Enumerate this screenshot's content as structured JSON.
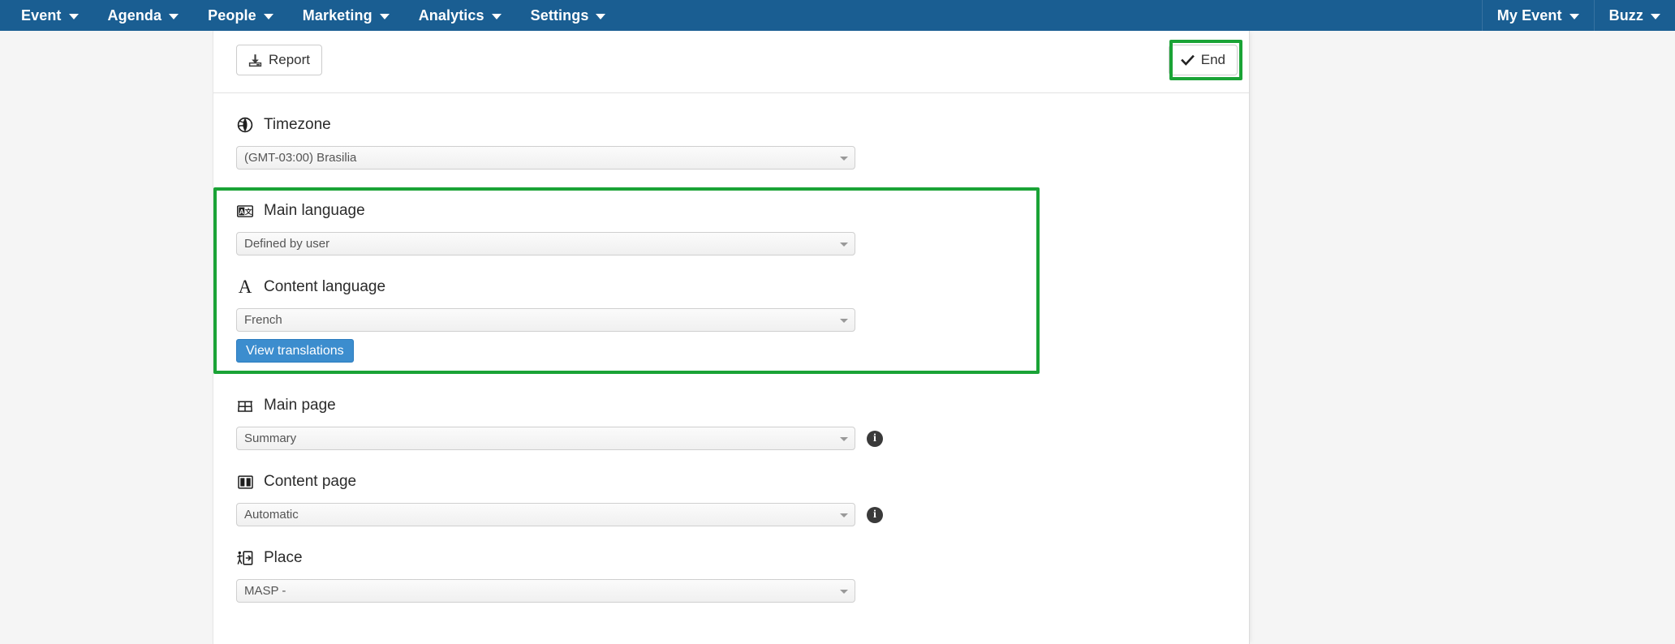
{
  "nav": {
    "left_items": [
      {
        "label": "Event",
        "icon": "chevron-down-icon"
      },
      {
        "label": "Agenda",
        "icon": "chevron-down-icon"
      },
      {
        "label": "People",
        "icon": "chevron-down-icon"
      },
      {
        "label": "Marketing",
        "icon": "chevron-down-icon"
      },
      {
        "label": "Analytics",
        "icon": "chevron-down-icon"
      },
      {
        "label": "Settings",
        "icon": "chevron-down-icon"
      }
    ],
    "right_items": [
      {
        "label": "My Event",
        "icon": "chevron-down-icon"
      },
      {
        "label": "Buzz",
        "icon": "chevron-down-icon"
      }
    ]
  },
  "action_bar": {
    "report_label": "Report",
    "report_icon": "download-icon",
    "end_label": "End",
    "end_icon": "check-icon",
    "end_highlighted": true
  },
  "highlight_color": "#1aa336",
  "accent_color": "#3c8dce",
  "nav_color": "#1a5e92",
  "fields": {
    "timezone": {
      "label": "Timezone",
      "icon": "globe-icon",
      "value": "(GMT-03:00) Brasilia"
    },
    "main_language": {
      "label": "Main language",
      "icon": "translate-icon",
      "value": "Defined by user"
    },
    "content_language": {
      "label": "Content language",
      "icon": "letter-a-icon",
      "value": "French",
      "button_label": "View translations"
    },
    "main_page": {
      "label": "Main page",
      "icon": "grid-icon",
      "value": "Summary",
      "info_icon": "info-icon",
      "info_glyph": "i"
    },
    "content_page": {
      "label": "Content page",
      "icon": "columns-icon",
      "value": "Automatic",
      "info_icon": "info-icon",
      "info_glyph": "i"
    },
    "place": {
      "label": "Place",
      "icon": "door-person-icon",
      "value": "MASP -"
    }
  }
}
